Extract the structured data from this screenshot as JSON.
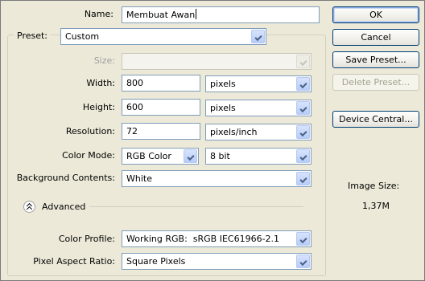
{
  "form": {
    "name_label": "Name:",
    "name_value": "Membuat Awan",
    "preset_label": "Preset:",
    "preset_value": "Custom",
    "size_label": "Size:",
    "size_value": "",
    "width_label": "Width:",
    "width_value": "800",
    "width_unit": "pixels",
    "height_label": "Height:",
    "height_value": "600",
    "height_unit": "pixels",
    "resolution_label": "Resolution:",
    "resolution_value": "72",
    "resolution_unit": "pixels/inch",
    "color_mode_label": "Color Mode:",
    "color_mode_value": "RGB Color",
    "bit_depth_value": "8 bit",
    "background_label": "Background Contents:",
    "background_value": "White",
    "advanced_label": "Advanced",
    "color_profile_label": "Color Profile:",
    "color_profile_value": "Working RGB:  sRGB IEC61966-2.1",
    "pixel_aspect_label": "Pixel Aspect Ratio:",
    "pixel_aspect_value": "Square Pixels"
  },
  "buttons": {
    "ok": "OK",
    "cancel": "Cancel",
    "save_preset": "Save Preset...",
    "delete_preset": "Delete Preset...",
    "device_central": "Device Central..."
  },
  "info": {
    "image_size_label": "Image Size:",
    "image_size_value": "1,37M"
  },
  "colors": {
    "dialog_bg": "#ece9d8",
    "input_border": "#7f9db9",
    "button_border": "#003c74",
    "disabled_text": "#a1a192"
  }
}
